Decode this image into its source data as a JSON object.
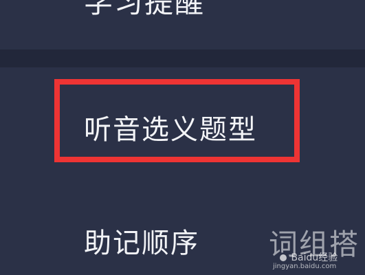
{
  "menu": {
    "top_item_label": "学习提醒",
    "items": [
      {
        "label": "听音选义题型",
        "highlighted": true
      },
      {
        "label": "助记顺序",
        "highlighted": false
      }
    ]
  },
  "annotation": {
    "highlight_color": "#ee3434"
  },
  "watermark": {
    "brand": "词组搭",
    "logo_text": "Baidu经验",
    "url": "jingyan.baidu.com"
  },
  "colors": {
    "background": "#2b3147",
    "divider": "#22273a",
    "text": "#f3f4f7"
  }
}
